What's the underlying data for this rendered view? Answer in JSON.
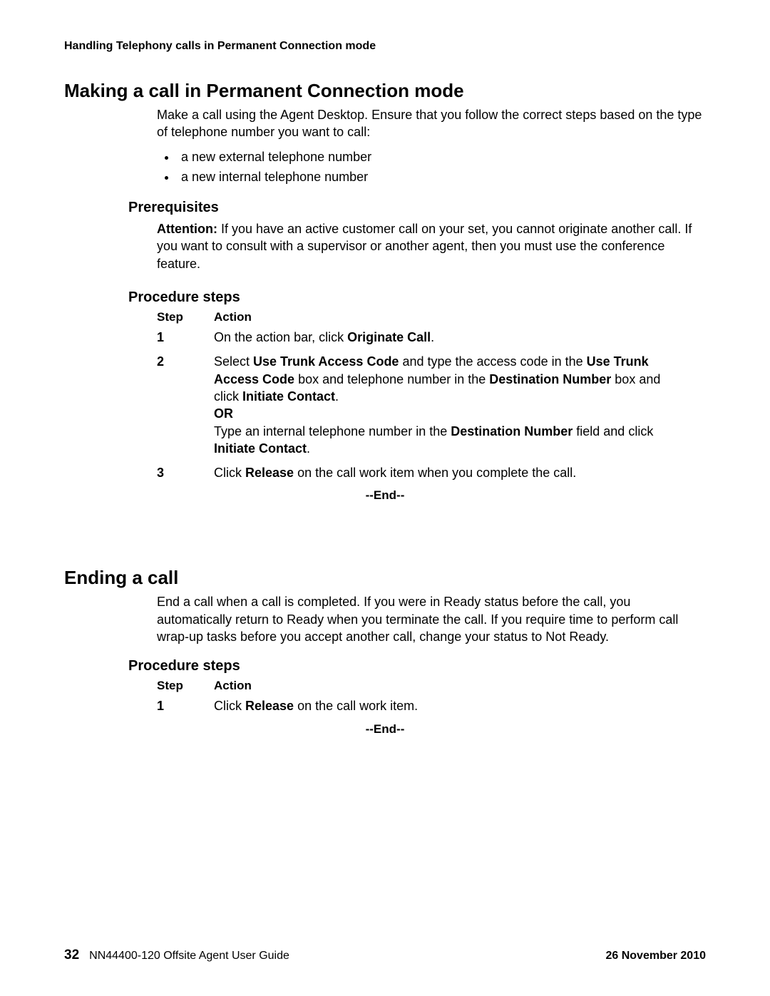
{
  "running_head": "Handling Telephony calls in Permanent Connection mode",
  "section1": {
    "title": "Making a call in Permanent Connection mode",
    "intro": "Make a call using the Agent Desktop. Ensure that you follow the correct steps based on the type of telephone number you want to call:",
    "bullets": [
      "a new external telephone number",
      "a new internal telephone number"
    ],
    "prereq_title": "Prerequisites",
    "attention_label": "Attention:",
    "attention_text": "If you have an active customer call on your set, you cannot originate another call. If you want to consult with a supervisor or another agent, then you must use the conference feature.",
    "procedure_title": "Procedure steps",
    "table_head_step": "Step",
    "table_head_action": "Action",
    "steps": [
      {
        "n": "1",
        "pre": "On the action bar, click ",
        "b1": "Originate Call",
        "post": "."
      },
      {
        "n": "2",
        "a_pre": "Select ",
        "a_b1": "Use Trunk Access Code",
        "a_mid1": " and type the access code in the ",
        "a_b2": "Use Trunk Access Code",
        "a_mid2": " box and telephone number in the ",
        "a_b3": "Destination Number",
        "a_mid3": " box and click ",
        "a_b4": "Initiate Contact",
        "a_post": ".",
        "or": "OR",
        "b_pre": "Type an internal telephone number in the ",
        "b_b1": "Destination Number",
        "b_mid1": " field and click ",
        "b_b2": "Initiate Contact",
        "b_post": "."
      },
      {
        "n": "3",
        "pre": "Click ",
        "b1": "Release",
        "post": " on the call work item when you complete the call."
      }
    ],
    "end": "--End--"
  },
  "section2": {
    "title": "Ending a call",
    "intro": "End a call when a call is completed. If you were in Ready status before the call, you automatically return to Ready when you terminate the call. If you require time to perform call wrap-up tasks before you accept another call, change your status to Not Ready.",
    "procedure_title": "Procedure steps",
    "table_head_step": "Step",
    "table_head_action": "Action",
    "step1_n": "1",
    "step1_pre": "Click ",
    "step1_b1": "Release",
    "step1_post": " on the call work item.",
    "end": "--End--"
  },
  "footer": {
    "page": "32",
    "doc": "NN44400-120 Offsite Agent User Guide",
    "date": "26 November 2010"
  }
}
